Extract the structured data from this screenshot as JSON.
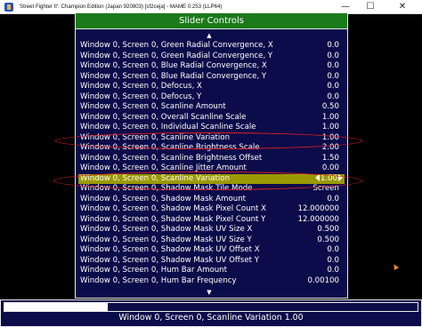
{
  "window": {
    "title": "Street Fighter II': Champion Edition (Japan 920803) [sf2ceja] - MAME 0.253 (LLP64)",
    "minimize_glyph": "—",
    "maximize_glyph": "☐",
    "close_glyph": "✕"
  },
  "panel": {
    "header": "Slider Controls",
    "scroll_up_glyph": "▲",
    "scroll_down_glyph": "▼"
  },
  "rows": [
    {
      "name": "Window 0, Screen 0, Green Radial Convergence, X",
      "value": "0.0"
    },
    {
      "name": "Window 0, Screen 0, Green Radial Convergence, Y",
      "value": "0.0"
    },
    {
      "name": "Window 0, Screen 0, Blue Radial Convergence, X",
      "value": "0.0"
    },
    {
      "name": "Window 0, Screen 0, Blue Radial Convergence, Y",
      "value": "0.0"
    },
    {
      "name": "Window 0, Screen 0, Defocus, X",
      "value": "0.0"
    },
    {
      "name": "Window 0, Screen 0, Defocus, Y",
      "value": "0.0"
    },
    {
      "name": "Window 0, Screen 0, Scanline Amount",
      "value": "0.50"
    },
    {
      "name": "Window 0, Screen 0, Overall Scanline Scale",
      "value": "1.00"
    },
    {
      "name": "Window 0, Screen 0, Individual Scanline Scale",
      "value": "1.00"
    },
    {
      "name": "Window 0, Screen 0, Scanline Variation",
      "value": "1.00"
    },
    {
      "name": "Window 0, Screen 0, Scanline Brightness Scale",
      "value": "2.00"
    },
    {
      "name": "Window 0, Screen 0, Scanline Brightness Offset",
      "value": "1.50"
    },
    {
      "name": "Window 0, Screen 0, Scanline Jitter Amount",
      "value": "0.00"
    },
    {
      "name": "Window 0, Screen 0, Scanline Variation",
      "value": "1.00",
      "selected": true
    },
    {
      "name": "Window 0, Screen 0, Shadow Mask Tile Mode",
      "value": "Screen"
    },
    {
      "name": "Window 0, Screen 0, Shadow Mask Amount",
      "value": "0.0"
    },
    {
      "name": "Window 0, Screen 0, Shadow Mask Pixel Count X",
      "value": "12.000000"
    },
    {
      "name": "Window 0, Screen 0, Shadow Mask Pixel Count Y",
      "value": "12.000000"
    },
    {
      "name": "Window 0, Screen 0, Shadow Mask UV Size X",
      "value": "0.500"
    },
    {
      "name": "Window 0, Screen 0, Shadow Mask UV Size Y",
      "value": "0.500"
    },
    {
      "name": "Window 0, Screen 0, Shadow Mask UV Offset X",
      "value": "0.0"
    },
    {
      "name": "Window 0, Screen 0, Shadow Mask UV Offset Y",
      "value": "0.0"
    },
    {
      "name": "Window 0, Screen 0, Hum Bar Amount",
      "value": "0.0"
    },
    {
      "name": "Window 0, Screen 0, Hum Bar Frequency",
      "value": "0.00100"
    }
  ],
  "bottom": {
    "status_text": "Window 0, Screen 0, Scanline Variation 1.00",
    "slider_fraction": 0.25
  },
  "colors": {
    "panel_background": "#0c0c4a",
    "header_background": "#1a7a1a",
    "selected_row": "#9a9a00",
    "annotation_outline": "#e02020"
  }
}
